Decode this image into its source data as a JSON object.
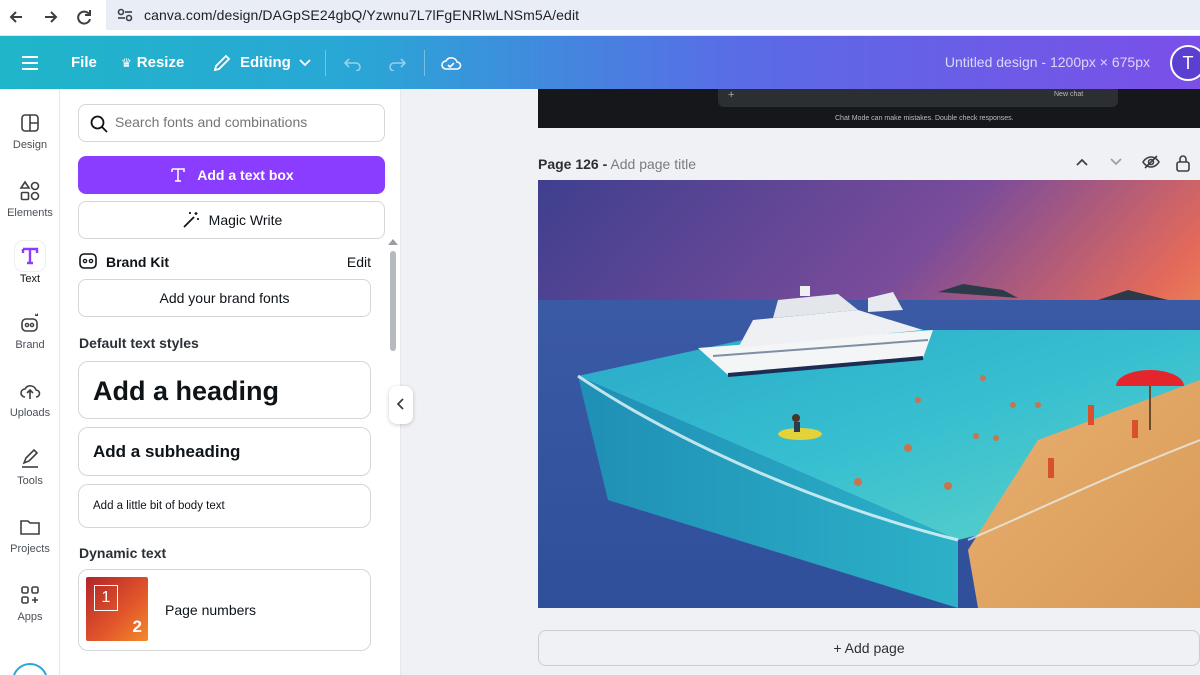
{
  "browser": {
    "url": "canva.com/design/DAGpSE24gbQ/Yzwnu7L7lFgENRlwLNSm5A/edit"
  },
  "topbar": {
    "file": "File",
    "resize": "Resize",
    "editing": "Editing",
    "title": "Untitled design - 1200px × 675px",
    "avatar": "T"
  },
  "rail": {
    "items": [
      {
        "label": "Design",
        "icon": "layout-icon"
      },
      {
        "label": "Elements",
        "icon": "shapes-icon"
      },
      {
        "label": "Text",
        "icon": "text-T-icon"
      },
      {
        "label": "Brand",
        "icon": "brand-icon"
      },
      {
        "label": "Uploads",
        "icon": "cloud-upload-icon"
      },
      {
        "label": "Tools",
        "icon": "pen-tool-icon"
      },
      {
        "label": "Projects",
        "icon": "folder-icon"
      },
      {
        "label": "Apps",
        "icon": "apps-grid-icon"
      }
    ]
  },
  "panel": {
    "search_placeholder": "Search fonts and combinations",
    "add_text_box": "Add a text box",
    "magic_write": "Magic Write",
    "brand_kit": "Brand Kit",
    "brand_kit_edit": "Edit",
    "add_brand_fonts": "Add your brand fonts",
    "default_styles_title": "Default text styles",
    "heading": "Add a heading",
    "subheading": "Add a subheading",
    "body": "Add a little bit of body text",
    "dynamic_title": "Dynamic text",
    "page_numbers": "Page numbers",
    "thumb_num_1": "1",
    "thumb_num_2": "2"
  },
  "canvas": {
    "prev_newchat": "New chat",
    "prev_disclaimer": "Chat Mode can make mistakes. Double check responses.",
    "page_label": "Page 126 -",
    "page_title_placeholder": "Add page title",
    "add_page": "+ Add page"
  },
  "colors": {
    "accent": "#8b3dff",
    "topbar_start": "#1fb6c9",
    "topbar_end": "#7b4fe8"
  }
}
